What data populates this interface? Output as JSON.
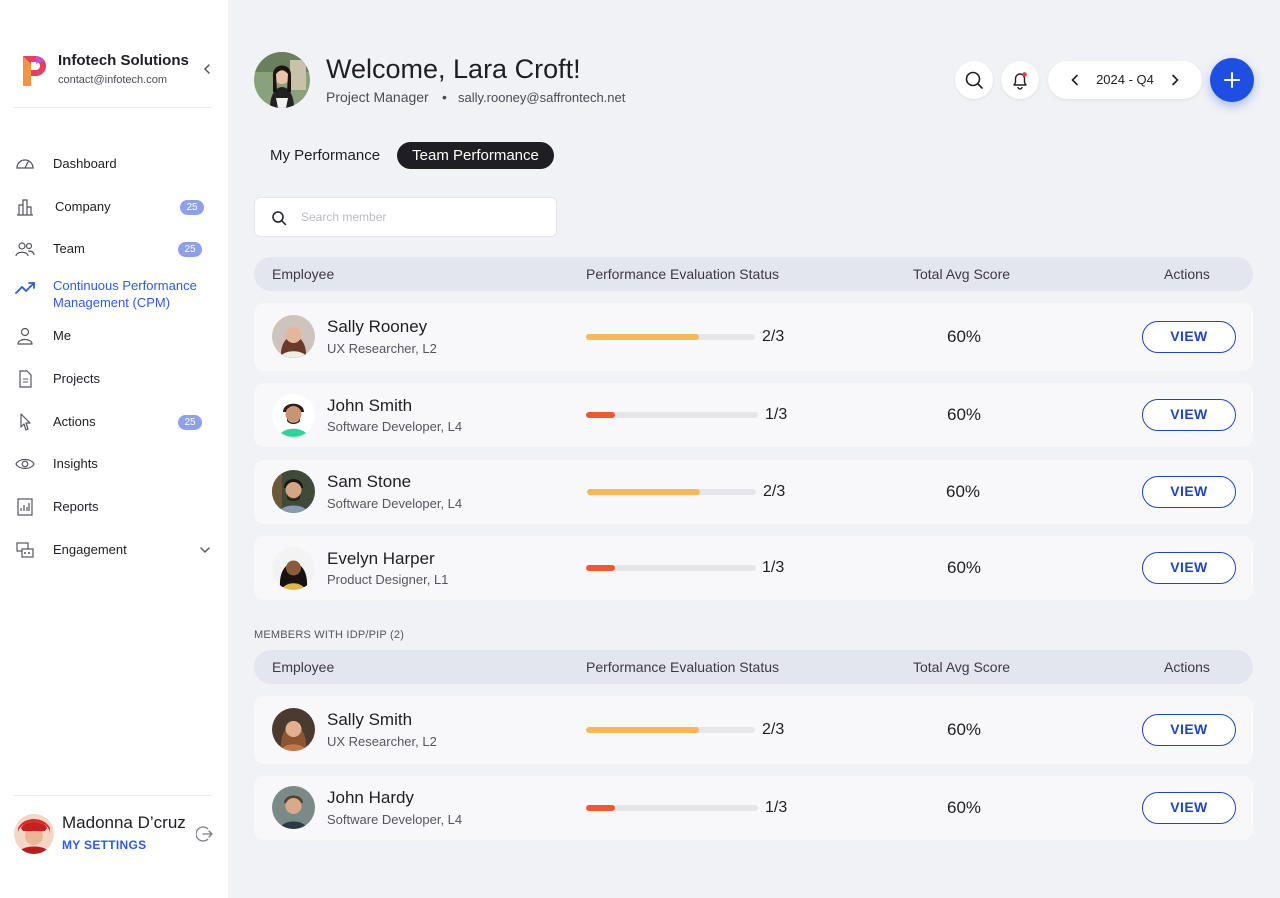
{
  "org": {
    "name": "Infotech Solutions",
    "email": "contact@infotech.com"
  },
  "nav": {
    "items": [
      {
        "label": "Dashboard",
        "icon": "dashboard-gauge-icon"
      },
      {
        "label": "Company",
        "badge": "25",
        "icon": "company-buildings-icon"
      },
      {
        "label": "Team",
        "badge": "25",
        "icon": "team-users-icon"
      },
      {
        "label": "Continuous Performance Management (CPM)",
        "icon": "trend-line-icon",
        "active": true
      },
      {
        "label": "Me",
        "icon": "user-icon"
      },
      {
        "label": "Projects",
        "icon": "document-icon"
      },
      {
        "label": "Actions",
        "badge": "25",
        "icon": "action-cursor-icon"
      },
      {
        "label": "Insights",
        "icon": "eye-icon"
      },
      {
        "label": "Reports",
        "icon": "report-icon"
      },
      {
        "label": "Engagement",
        "icon": "engagement-icon"
      }
    ]
  },
  "current_user": {
    "name": "Madonna D’cruz",
    "settings_label": "MY SETTINGS"
  },
  "header": {
    "welcome": "Welcome, Lara Croft!",
    "role": "Project Manager",
    "separator": "•",
    "email": "sally.rooney@saffrontech.net",
    "period": "2024 - Q4"
  },
  "tabs": {
    "my": "My Performance",
    "team": "Team Performance",
    "active": "team"
  },
  "search": {
    "placeholder": "Search member"
  },
  "columns": {
    "employee": "Employee",
    "status": "Performance Evaluation Status",
    "score": "Total Avg Score",
    "actions": "Actions"
  },
  "colors": {
    "accent": "#1f4fe0",
    "progress_mid": "#f5b85a",
    "progress_low": "#ec5a35"
  },
  "members": [
    {
      "name": "Sally Rooney",
      "title": "UX Researcher, L2",
      "progress": 0.67,
      "progress_label": "2/3",
      "score": "60%",
      "view_label": "VIEW"
    },
    {
      "name": "John Smith",
      "title": "Software Developer, L4",
      "progress": 0.17,
      "progress_label": "1/3",
      "score": "60%",
      "view_label": "VIEW"
    },
    {
      "name": "Sam Stone",
      "title": "Software Developer, L4",
      "progress": 0.67,
      "progress_label": "2/3",
      "score": "60%",
      "view_label": "VIEW"
    },
    {
      "name": "Evelyn Harper",
      "title": "Product Designer, L1",
      "progress": 0.17,
      "progress_label": "1/3",
      "score": "60%",
      "view_label": "VIEW"
    }
  ],
  "idp_section": {
    "title": "MEMBERS WITH IDP/PIP (2)",
    "members": [
      {
        "name": "Sally Smith",
        "title": "UX Researcher, L2",
        "progress": 0.67,
        "progress_label": "2/3",
        "score": "60%",
        "view_label": "VIEW"
      },
      {
        "name": "John Hardy",
        "title": "Software Developer, L4",
        "progress": 0.17,
        "progress_label": "1/3",
        "score": "60%",
        "view_label": "VIEW"
      }
    ]
  }
}
